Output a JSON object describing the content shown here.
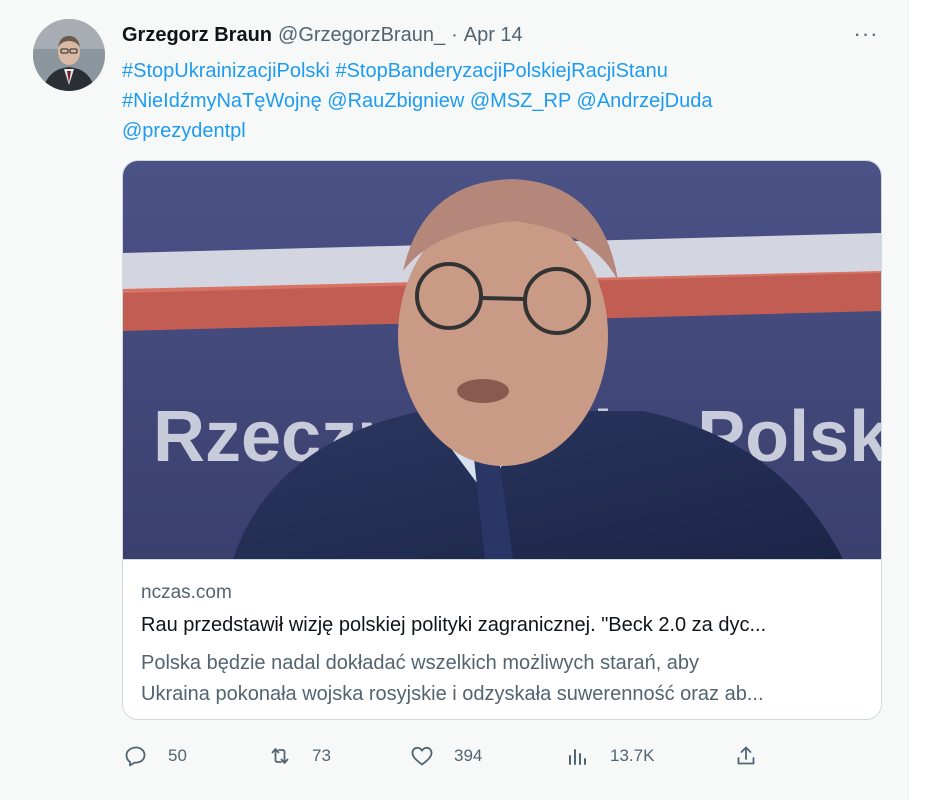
{
  "author": {
    "name": "Grzegorz Braun",
    "handle": "@GrzegorzBraun_",
    "separator": "·",
    "date": "Apr 14"
  },
  "more_label": "···",
  "tweet_text": {
    "line1": [
      "#StopUkrainizacjiPolski",
      "#StopBanderyzacjiPolskiejRacjiStanu"
    ],
    "line2": [
      "#NieIdźmyNaTęWojnę",
      "@RauZbigniew",
      "@MSZ_RP",
      "@AndrzejDuda"
    ],
    "line3": [
      "@prezydentpl"
    ]
  },
  "link_card": {
    "image_text": "Rzeczpospolita Polska",
    "domain": "nczas.com",
    "title": "Rau przedstawił wizję polskiej polityki zagranicznej. \"Beck 2.0 za dyc...",
    "description_line1": "Polska będzie nadal dokładać wszelkich możliwych starań, aby",
    "description_line2": "Ukraina pokonała wojska rosyjskie i odzyskała suwerenność oraz ab..."
  },
  "actions": {
    "replies": "50",
    "retweets": "73",
    "likes": "394",
    "views": "13.7K"
  },
  "icons": {
    "reply": "reply-icon",
    "retweet": "retweet-icon",
    "like": "heart-icon",
    "views": "views-icon",
    "share": "share-icon"
  },
  "colors": {
    "link": "#1d9bf0",
    "secondary_text": "#536471",
    "primary_text": "#0f1419",
    "background": "#f7f9f9",
    "border": "#cfd9de"
  }
}
